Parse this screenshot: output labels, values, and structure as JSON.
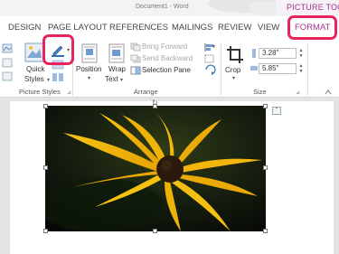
{
  "title_bar": {
    "document_title": "Document1 - Word",
    "context_label": "PICTURE TOO..."
  },
  "tabs": [
    "DESIGN",
    "PAGE LAYOUT",
    "REFERENCES",
    "MAILINGS",
    "REVIEW",
    "VIEW",
    "FORMAT"
  ],
  "ribbon": {
    "picture_styles": {
      "quick_styles": "Quick",
      "styles_line2": "Styles",
      "group_label": "Picture Styles"
    },
    "arrange": {
      "position": "Position",
      "wrap_text": "Wrap",
      "wrap_text_line2": "Text",
      "bring_forward": "Bring Forward",
      "send_backward": "Send Backward",
      "selection_pane": "Selection Pane",
      "group_label": "Arrange"
    },
    "size": {
      "crop": "Crop",
      "height": "3.28\"",
      "width": "5.85\"",
      "group_label": "Size"
    }
  },
  "colors": {
    "accent": "#a2318a",
    "highlight": "#e8245c",
    "petal": "#f5b50a",
    "center": "#2a1a0d"
  }
}
